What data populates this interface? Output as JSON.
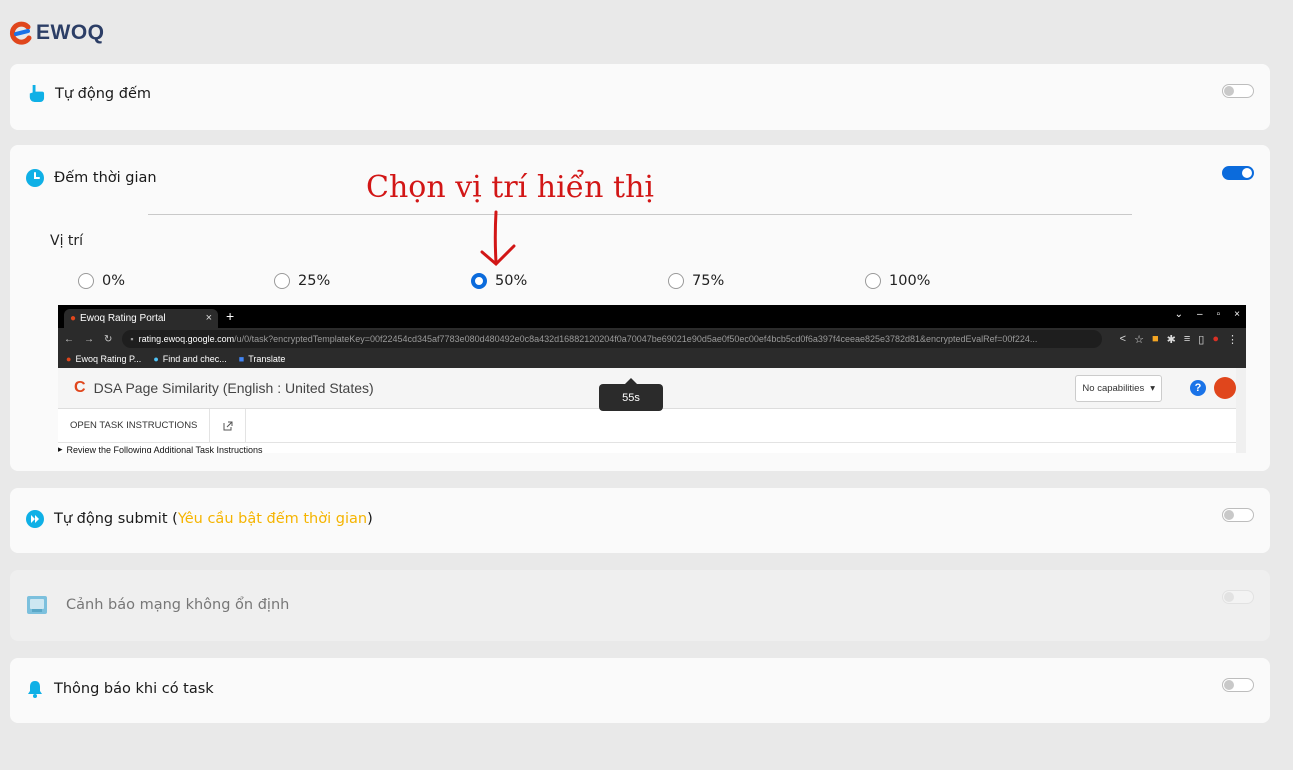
{
  "app": {
    "logo_text": "EWOQ"
  },
  "settings": {
    "auto_count": {
      "label": "Tự động đếm",
      "icon": "hand-pointer-icon",
      "enabled": false
    },
    "timer": {
      "label": "Đếm thời gian",
      "icon": "clock-icon",
      "enabled": true,
      "annotation": "Chọn vị trí hiển thị",
      "position_label": "Vị trí",
      "positions": [
        "0%",
        "25%",
        "50%",
        "75%",
        "100%"
      ],
      "selected_position": "50%"
    },
    "auto_submit": {
      "label": "Tự động submit",
      "hint_open": "(",
      "hint": "Yêu cầu bật đếm thời gian",
      "hint_close": ")",
      "icon": "fast-forward-icon",
      "enabled": false
    },
    "network_warning": {
      "label": "Cảnh báo mạng không ổn định",
      "icon": "network-icon",
      "enabled": false,
      "disabled": true
    },
    "task_notify": {
      "label": "Thông báo khi có task",
      "icon": "bell-icon",
      "enabled": false
    }
  },
  "preview": {
    "tab_title": "Ewoq Rating Portal",
    "url_host": "rating.ewoq.google.com",
    "url_path": "/u/0/task?encryptedTemplateKey=00f22454cd345af7783e080d480492e0c8a432d16882120204f0a70047be69021e90d5ae0f50ec00ef4bcb5cd0f6a397f4ceeae825e3782d81&encryptedEvalRef=00f224...",
    "bookmarks": [
      "Ewoq Rating P...",
      "Find and chec...",
      "Translate"
    ],
    "page_title": "DSA Page Similarity (English : United States)",
    "timer_text": "55s",
    "capabilities": "No capabilities",
    "open_instructions": "OPEN TASK INSTRUCTIONS",
    "review_text": "Review the Following Additional Task Instructions"
  },
  "colors": {
    "accent": "#0b6bdc",
    "icon_cyan": "#0fb0e6",
    "hint": "#f5b400",
    "annotation": "#d21616"
  }
}
